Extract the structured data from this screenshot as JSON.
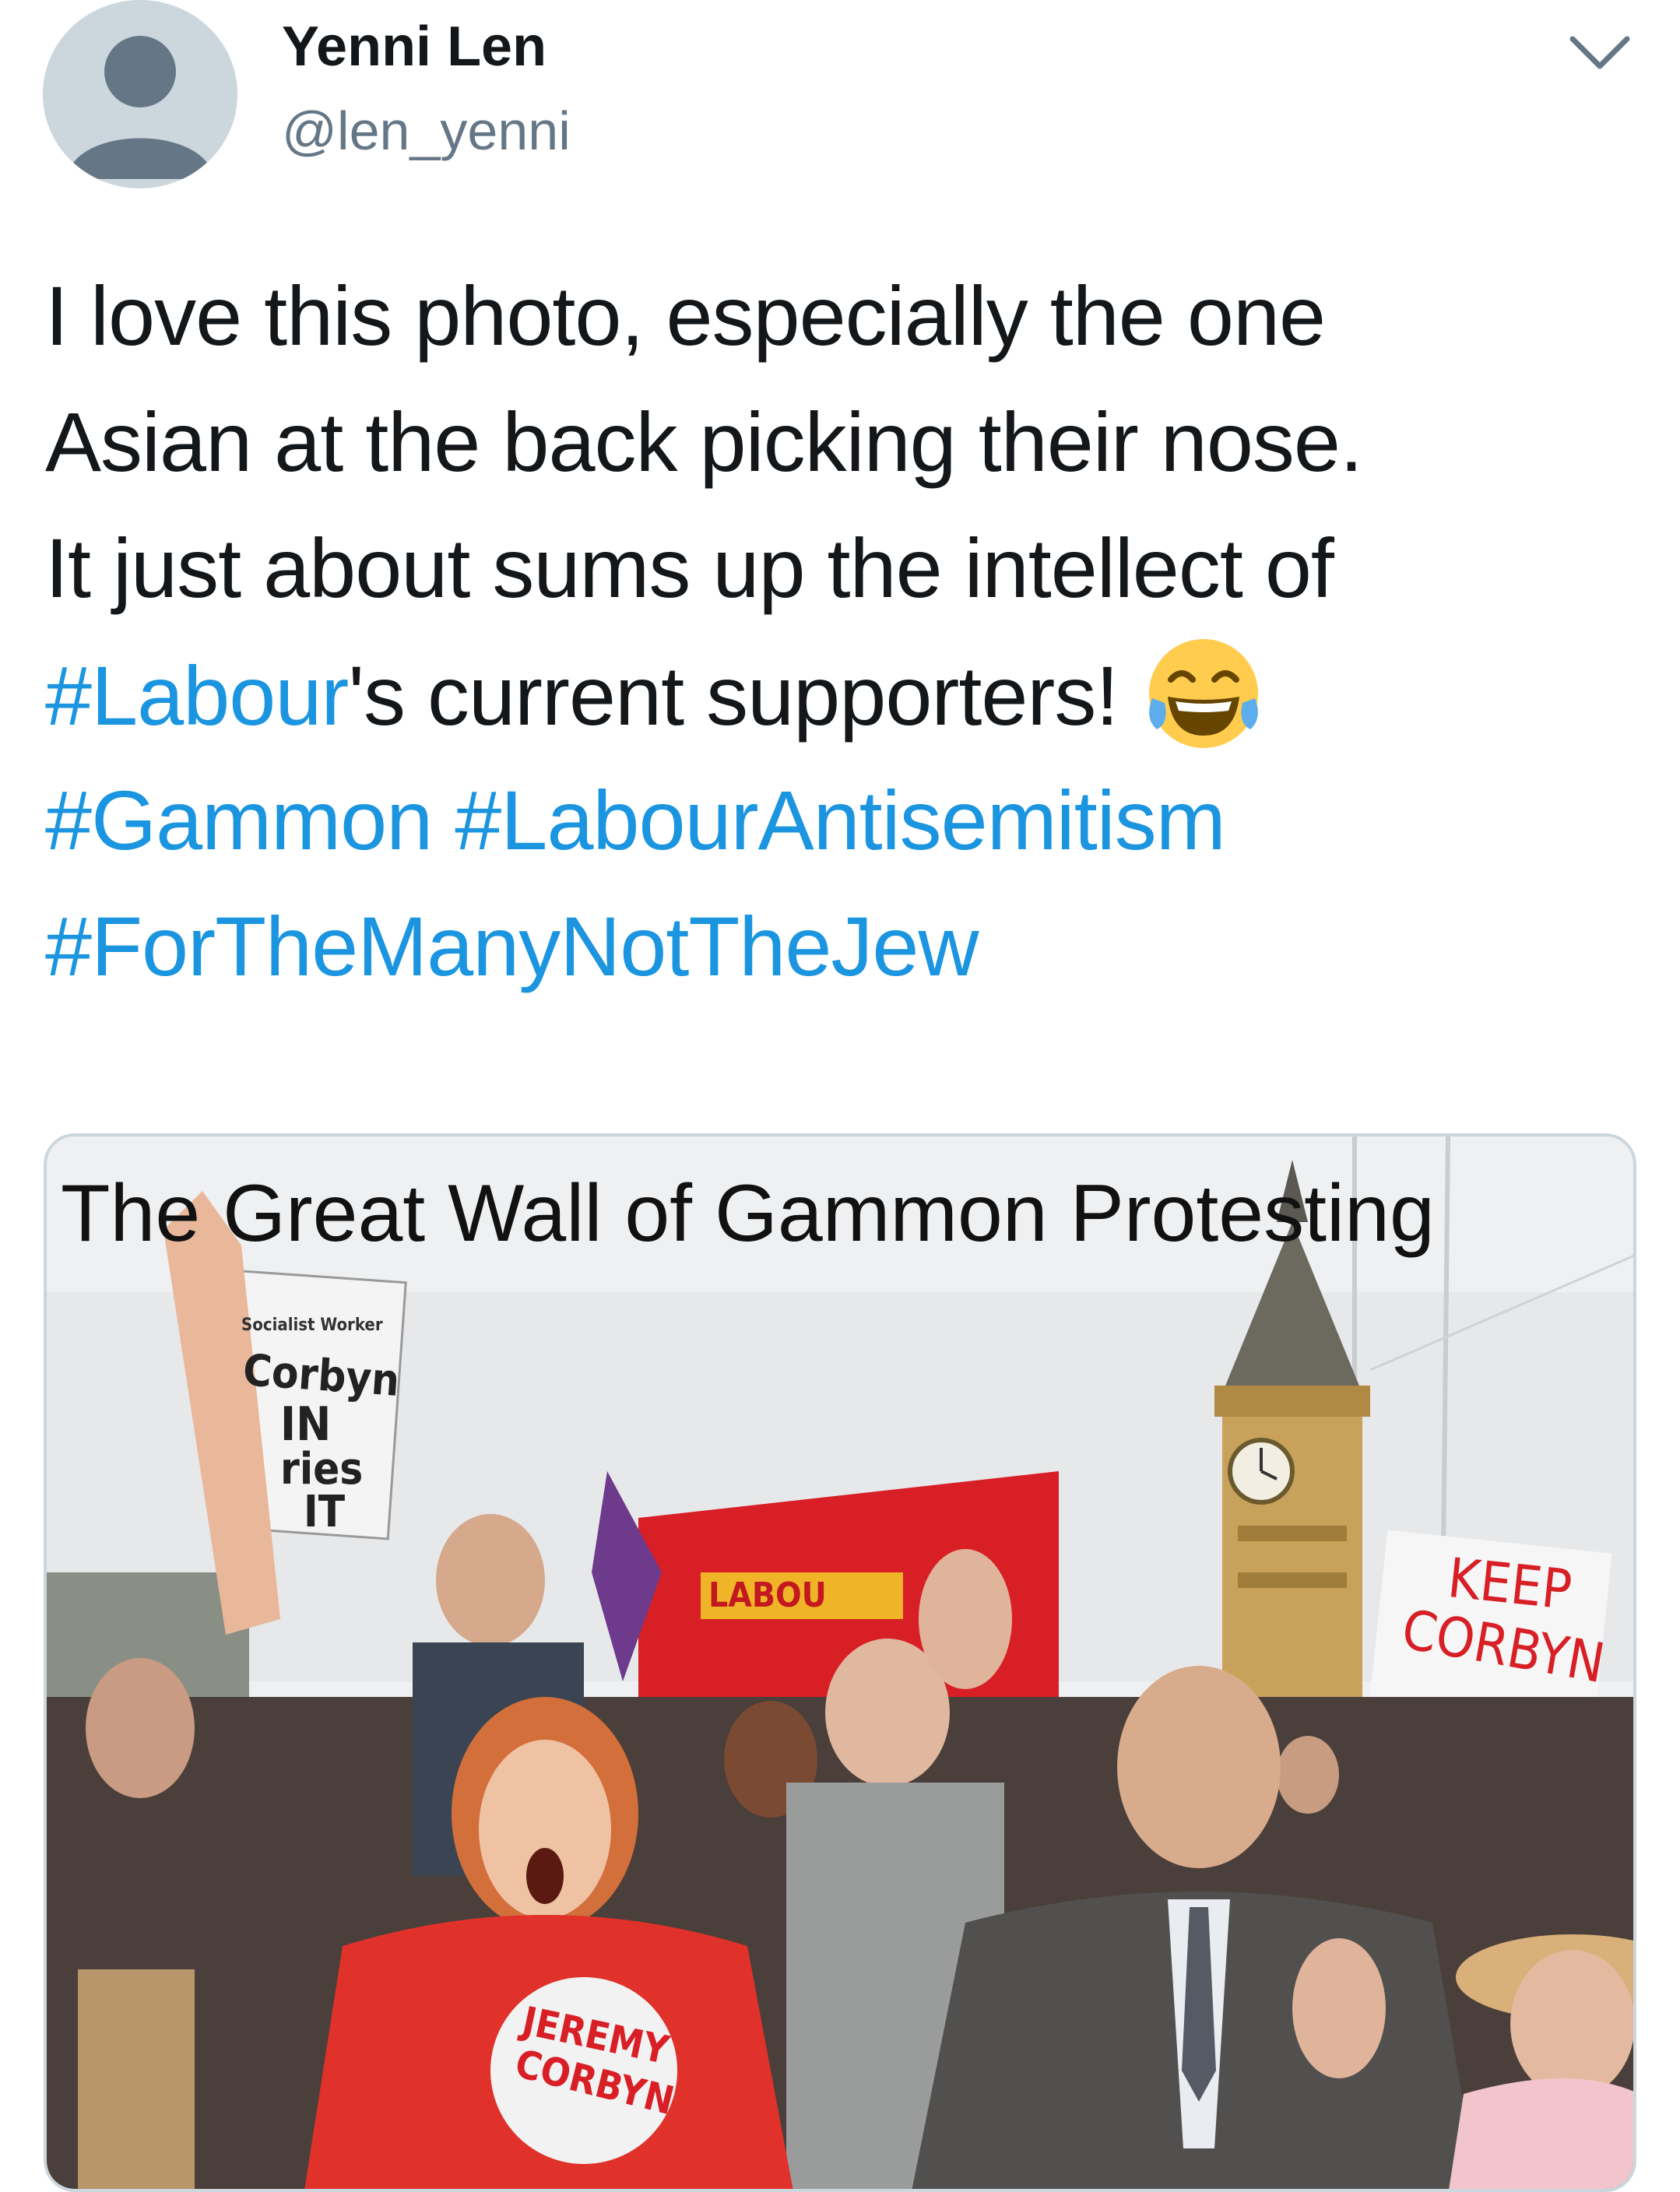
{
  "user": {
    "display_name": "Yenni Len",
    "handle": "@len_yenni"
  },
  "tweet": {
    "line1": "I love this photo, especially the one",
    "line2": "Asian at the back picking their nose.",
    "line3": "It just about sums up the intellect of",
    "hashtag_labour": "#Labour",
    "line4_rest": "'s current supporters!",
    "hashtag_gammon": "#Gammon",
    "hashtag_antisemitism": "#LabourAntisemitism",
    "hashtag_forthemany": "#ForTheManyNotTheJew",
    "emoji": "face-with-tears-of-joy"
  },
  "media": {
    "caption": "The Great Wall of Gammon Protesting",
    "signs": {
      "socialist_worker": "Socialist Worker",
      "corbyn": "Corbyn",
      "in": "IN",
      "ries": "ries",
      "it": "IT",
      "labour_banner": "LABOU",
      "keep": "KEEP",
      "corbyn_sign": "CORBYN",
      "jeremy": "JEREMY",
      "corbyn_shirt": "CORBYN"
    }
  },
  "colors": {
    "hashtag": "#1b95e0",
    "handle": "#657786",
    "text": "#14171a",
    "border": "#ccd6dd"
  }
}
